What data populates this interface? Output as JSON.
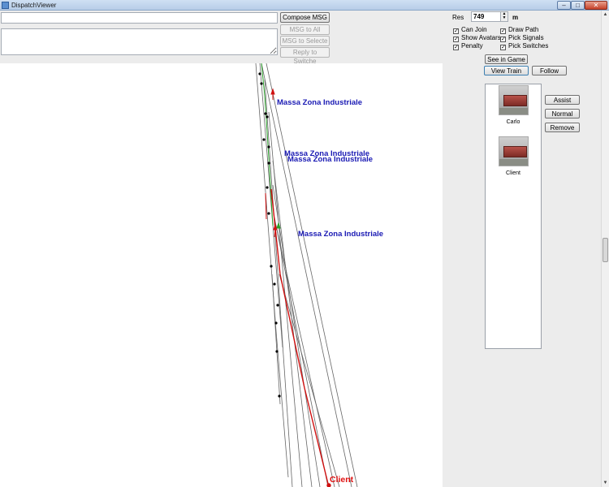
{
  "window": {
    "title": "DispatchViewer",
    "minimize": "–",
    "maximize": "□",
    "close": "✕",
    "icon": "app-icon"
  },
  "message": {
    "line_value": "",
    "area_value": "",
    "compose_label": "Compose MSG",
    "msg_all_label": "MSG to All",
    "msg_selected_label": "MSG to Selecte",
    "reply_switches_label": "Reply to Switche"
  },
  "resolution": {
    "label": "Res",
    "value": "749",
    "unit": "m",
    "spin_up": "▲",
    "spin_down": "▼"
  },
  "options": {
    "can_join": {
      "label": "Can Join",
      "checked": true
    },
    "show_avatars": {
      "label": "Show Avatars",
      "checked": true
    },
    "penalty": {
      "label": "Penalty",
      "checked": true
    },
    "draw_path": {
      "label": "Draw Path",
      "checked": true
    },
    "pick_signals": {
      "label": "Pick Signals",
      "checked": true
    },
    "pick_switches": {
      "label": "Pick Switches",
      "checked": true
    },
    "check_glyph": "✓"
  },
  "view": {
    "see_in_game": "See in Game",
    "view_train": "View Train",
    "follow": "Follow"
  },
  "avatars": [
    {
      "name": "Carlo"
    },
    {
      "name": "Client"
    }
  ],
  "avatar_actions": {
    "assist": "Assist",
    "normal": "Normal",
    "remove": "Remove"
  },
  "map": {
    "station_labels": [
      "Massa Zona Industriale",
      "Massa Zona Industriale",
      "Massa Zona Industriale",
      "Massa Zona Industriale"
    ],
    "train_label": "Client",
    "colors": {
      "station": "#1a1ab4",
      "train": "#e01010",
      "path": "#2aa02a",
      "track": "#555555"
    }
  },
  "scrollbar": {
    "up": "▲",
    "down": "▼"
  }
}
